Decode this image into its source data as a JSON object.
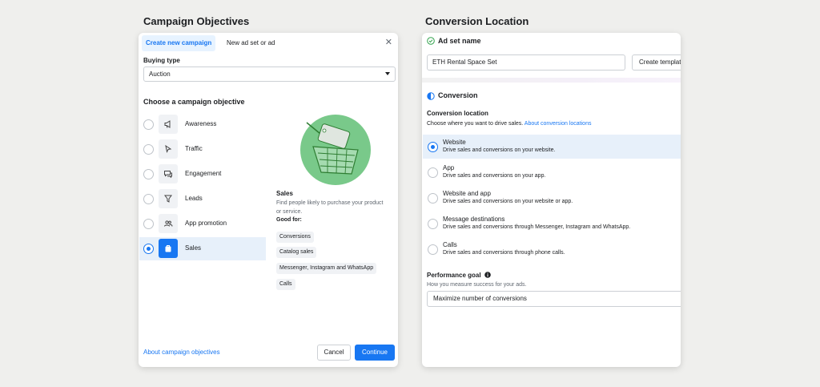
{
  "left": {
    "section_title": "Campaign Objectives",
    "tabs": [
      {
        "label": "Create new campaign",
        "active": true
      },
      {
        "label": "New ad set or ad",
        "active": false
      }
    ],
    "buying_type": {
      "label": "Buying type",
      "value": "Auction"
    },
    "objective_heading": "Choose a campaign objective",
    "objectives": [
      {
        "label": "Awareness",
        "icon": "megaphone-icon",
        "selected": false
      },
      {
        "label": "Traffic",
        "icon": "cursor-icon",
        "selected": false
      },
      {
        "label": "Engagement",
        "icon": "chat-bubbles-icon",
        "selected": false
      },
      {
        "label": "Leads",
        "icon": "funnel-icon",
        "selected": false
      },
      {
        "label": "App promotion",
        "icon": "people-icon",
        "selected": false
      },
      {
        "label": "Sales",
        "icon": "shopping-bag-icon",
        "selected": true
      }
    ],
    "detail": {
      "title": "Sales",
      "description": "Find people likely to purchase your product or service.",
      "good_for_label": "Good for:",
      "good_for": [
        "Conversions",
        "Catalog sales",
        "Messenger, Instagram and WhatsApp",
        "Calls"
      ]
    },
    "about_link": "About campaign objectives",
    "cancel_label": "Cancel",
    "continue_label": "Continue"
  },
  "right": {
    "section_title": "Conversion Location",
    "adset_heading": "Ad set name",
    "adset_value": "ETH Rental Space Set",
    "create_template_label": "Create template",
    "conversion_heading": "Conversion",
    "conversion_location_label": "Conversion location",
    "conversion_location_sub": "Choose where you want to drive sales.",
    "conversion_location_link": "About conversion locations",
    "locations": [
      {
        "title": "Website",
        "desc": "Drive sales and conversions on your website.",
        "selected": true
      },
      {
        "title": "App",
        "desc": "Drive sales and conversions on your app.",
        "selected": false
      },
      {
        "title": "Website and app",
        "desc": "Drive sales and conversions on your website or app.",
        "selected": false
      },
      {
        "title": "Message destinations",
        "desc": "Drive sales and conversions through Messenger, Instagram and WhatsApp.",
        "selected": false
      },
      {
        "title": "Calls",
        "desc": "Drive sales and conversions through phone calls.",
        "selected": false
      }
    ],
    "performance_goal_label": "Performance goal",
    "performance_goal_sub": "How you measure success for your ads.",
    "performance_goal_value": "Maximize number of conversions"
  },
  "colors": {
    "accent": "#1877f2",
    "selected_bg": "#e7f0fa",
    "background": "#efefed",
    "illustration": "#79c98a"
  }
}
